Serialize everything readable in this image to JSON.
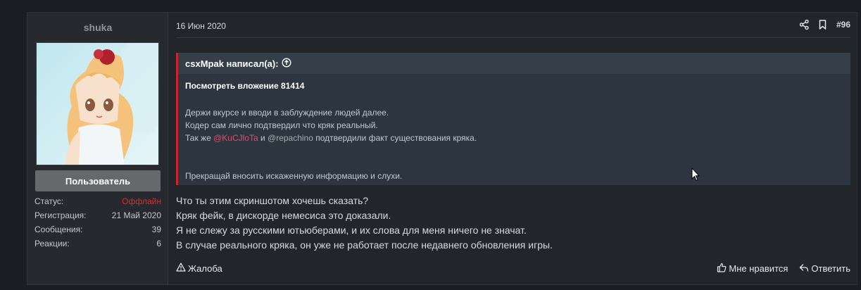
{
  "user": {
    "name": "shuka",
    "role": "Пользователь",
    "stats": [
      {
        "label": "Статус:",
        "value": "Оффлайн",
        "status": "offline"
      },
      {
        "label": "Регистрация:",
        "value": "21 Май 2020"
      },
      {
        "label": "Сообщения:",
        "value": "39"
      },
      {
        "label": "Реакции:",
        "value": "6"
      }
    ]
  },
  "post": {
    "date": "16 Июн 2020",
    "number": "#96",
    "quote": {
      "author_line": "csxMpak написал(а):",
      "attachment": "Посмотреть вложение 81414",
      "line1": "Держи вкурсе и вводи в заблуждение людей далее.",
      "line2": "Кодер сам лично подтвердил что кряк реальный.",
      "line3_prefix": "Так же ",
      "mention1": "@KuCJloTa",
      "line3_mid": " и ",
      "mention2": "@repachino",
      "line3_suffix": " подтвердили факт существования кряка.",
      "line4": "Прекращай вносить искаженную информацию и слухи."
    },
    "message": [
      "Что ты этим скриншотом хочешь сказать?",
      "Кряк фейк, в дискорде немесиса это доказали.",
      "Я не слежу за русскими ютьюберами, и их слова для меня ничего не значат.",
      "В случае реального кряка, он уже не работает после недавнего обновления игры."
    ],
    "footer": {
      "report": "Жалоба",
      "dislike": "Мне нравится",
      "reply": "Ответить"
    }
  },
  "colors": {
    "offline": "#e02a2a",
    "quote_border": "#c8242b",
    "mention_red": "#e04c6c",
    "mention_blue": "#8fa1ff"
  },
  "icons": [
    "share-icon",
    "bookmark-icon",
    "arrow-up-circle-icon",
    "warning-icon",
    "thumbs-up-icon",
    "reply-icon"
  ]
}
